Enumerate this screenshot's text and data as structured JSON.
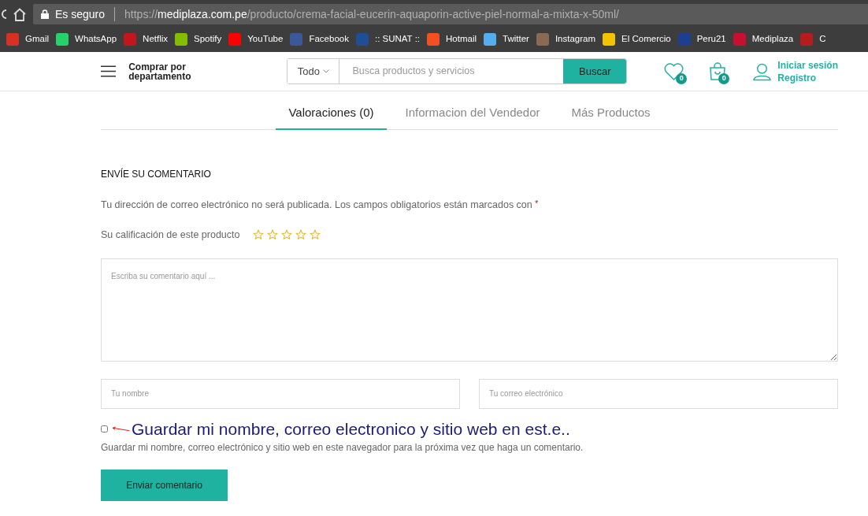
{
  "browser": {
    "security_label": "Es seguro",
    "url": [
      {
        "text": "https://",
        "kind": "dim"
      },
      {
        "text": "mediplaza.com.pe",
        "kind": "host"
      },
      {
        "text": "/producto/crema-facial-eucerin-aquaporin-active-piel-normal-a-mixta-x-50ml/",
        "kind": "dim"
      }
    ],
    "bookmarks": [
      {
        "label": "Gmail",
        "color": "#d93025"
      },
      {
        "label": "WhatsApp",
        "color": "#25d366"
      },
      {
        "label": "Netflix",
        "color": "#c4151c"
      },
      {
        "label": "Spotify",
        "color": "#84bd00"
      },
      {
        "label": "YouTube",
        "color": "#ff0000"
      },
      {
        "label": "Facebook",
        "color": "#3b5998"
      },
      {
        "label": ":: SUNAT ::",
        "color": "#1f4e96"
      },
      {
        "label": "Hotmail",
        "color": "#f25022"
      },
      {
        "label": "Twitter",
        "color": "#55acee"
      },
      {
        "label": "Instagram",
        "color": "#8a6a55"
      },
      {
        "label": "El Comercio",
        "color": "#f4c300"
      },
      {
        "label": "Peru21",
        "color": "#1c3f94"
      },
      {
        "label": "Mediplaza",
        "color": "#c8102e"
      },
      {
        "label": "C",
        "color": "#b71c1c"
      }
    ]
  },
  "header": {
    "department_menu": "Comprar por departamento",
    "search": {
      "category": "Todo",
      "placeholder": "Busca productos y servicios",
      "button": "Buscar"
    },
    "wishlist_count": "0",
    "cart_count": "0",
    "login": "Iniciar sesión",
    "register": "Registro"
  },
  "tabs": [
    {
      "label": "Valoraciones (0)",
      "selected": true
    },
    {
      "label": "Informacion del Vendedor",
      "selected": false
    },
    {
      "label": "Más Productos",
      "selected": false
    }
  ],
  "review_form": {
    "heading": "ENVÍE SU COMENTARIO",
    "note": "Tu dirección de correo electrónico no será publicada. Los campos obligatorios están marcados con",
    "required_mark": "*",
    "rating_label": "Su calificación de este producto",
    "stars": 0,
    "comment_placeholder": "Escriba su comentario aquí ...",
    "name_placeholder": "Tu nombre",
    "email_placeholder": "Tu correo electrónico",
    "save_checked": false,
    "annotation": "Guardar mi nombre, correo electronico y sitio web en est.e..",
    "save_label": "Guardar mi nombre, correo electrónico y sitio web en este navegador para la próxima vez que haga un comentario.",
    "submit": "Enviar comentario"
  }
}
